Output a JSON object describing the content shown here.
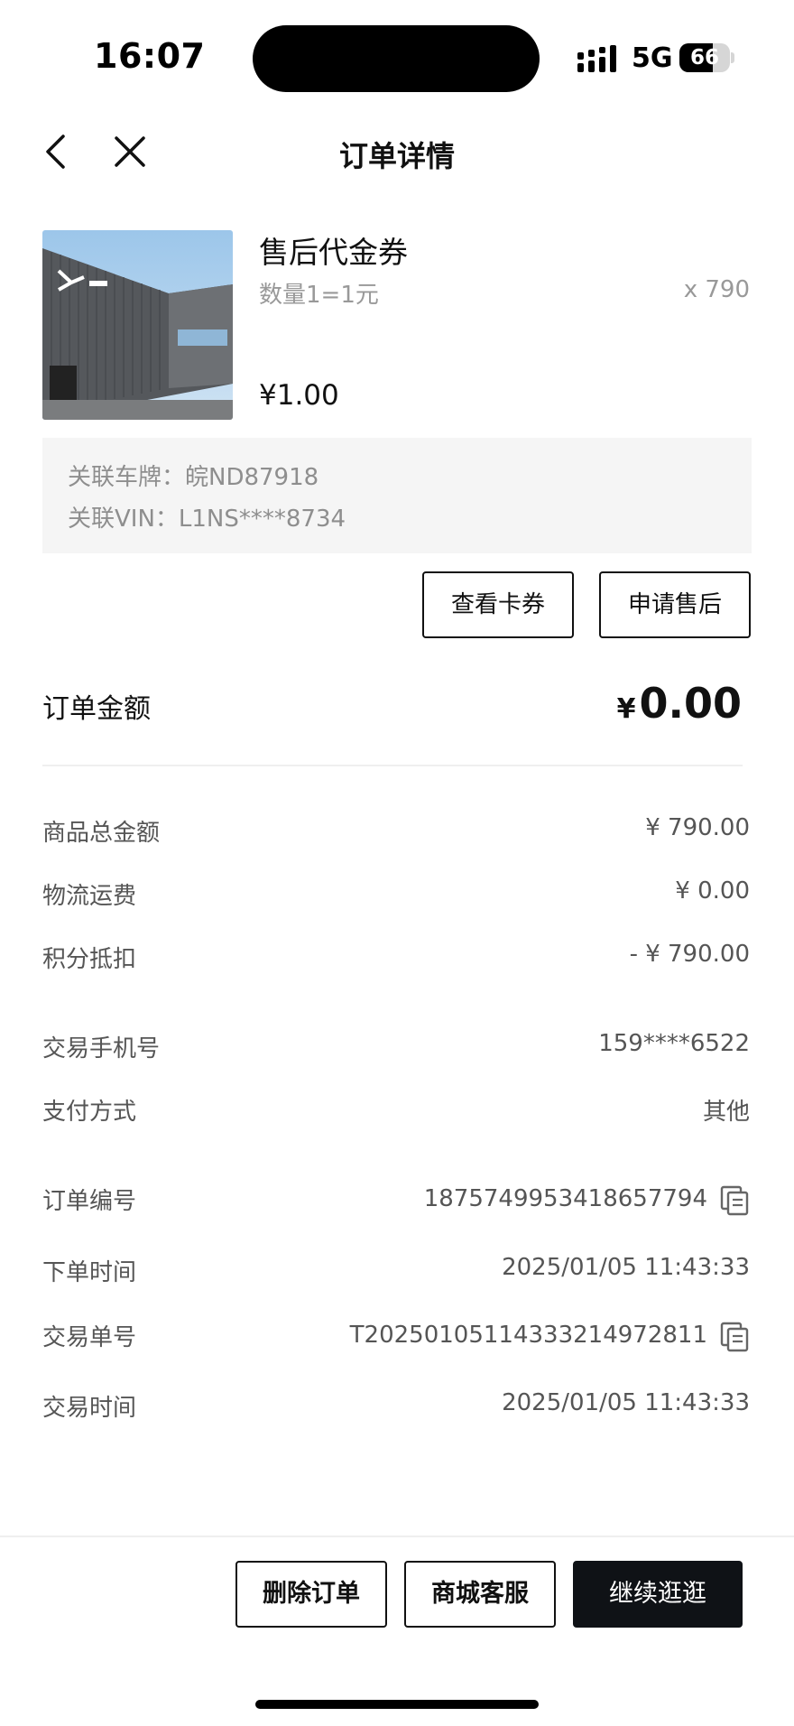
{
  "status_bar": {
    "time": "16:07",
    "network": "5G",
    "battery_percent": "66",
    "battery_level": 0.66
  },
  "nav": {
    "title": "订单详情",
    "back_icon": "chevron-left-icon",
    "close_icon": "close-icon"
  },
  "product": {
    "name": "售后代金券",
    "spec": "数量1=1元",
    "quantity": "x 790",
    "price": "¥1.00",
    "vehicle_plate": "关联车牌：皖ND87918",
    "vehicle_vin": "关联VIN：L1NS****8734"
  },
  "actions": {
    "view_coupon": "查看卡券",
    "apply_aftersale": "申请售后"
  },
  "order_amount": {
    "label": "订单金额",
    "currency": "¥",
    "value": "0.00"
  },
  "summary_rows": [
    {
      "label": "商品总金额",
      "value": "¥ 790.00"
    },
    {
      "label": "物流运费",
      "value": "¥ 0.00"
    },
    {
      "label": "积分抵扣",
      "value": "- ¥ 790.00"
    }
  ],
  "payment_rows": [
    {
      "label": "交易手机号",
      "value": "159****6522"
    },
    {
      "label": "支付方式",
      "value": "其他"
    }
  ],
  "order_rows": [
    {
      "label": "订单编号",
      "value": "1875749953418657794",
      "copy": true
    },
    {
      "label": "下单时间",
      "value": "2025/01/05 11:43:33",
      "copy": false
    },
    {
      "label": "交易单号",
      "value": "T202501051143332149728​11",
      "copy": true
    },
    {
      "label": "交易时间",
      "value": "2025/01/05 11:43:33",
      "copy": false
    }
  ],
  "bottom_bar": {
    "delete": "删除订单",
    "service": "商城客服",
    "continue": "继续逛逛"
  },
  "colors": {
    "primary_dark": "#0f1216",
    "muted_text": "#999999",
    "info_bg": "#f5f5f5"
  }
}
